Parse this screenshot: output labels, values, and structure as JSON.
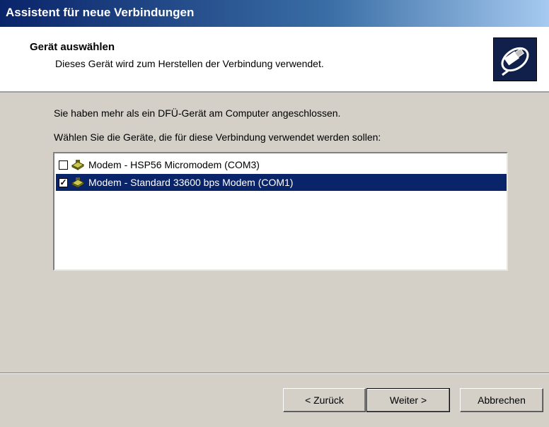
{
  "window": {
    "title": "Assistent für neue Verbindungen"
  },
  "header": {
    "title": "Gerät auswählen",
    "subtitle": "Dieses Gerät wird zum Herstellen der Verbindung verwendet.",
    "icon": "connection-plug-icon"
  },
  "content": {
    "line1": "Sie haben mehr als ein DFÜ-Gerät am Computer angeschlossen.",
    "line2": "Wählen Sie die Geräte, die für diese Verbindung verwendet werden sollen:"
  },
  "devices": [
    {
      "label": "Modem - HSP56 Micromodem (COM3)",
      "checked": false,
      "selected": false,
      "icon": "modem-icon"
    },
    {
      "label": "Modem - Standard 33600 bps Modem (COM1)",
      "checked": true,
      "selected": true,
      "icon": "modem-icon"
    }
  ],
  "buttons": {
    "back": "< Zurück",
    "next": "Weiter >",
    "cancel": "Abbrechen"
  },
  "colors": {
    "titlebar_start": "#0a246a",
    "selection": "#0a246a",
    "face": "#d4d0c8"
  }
}
